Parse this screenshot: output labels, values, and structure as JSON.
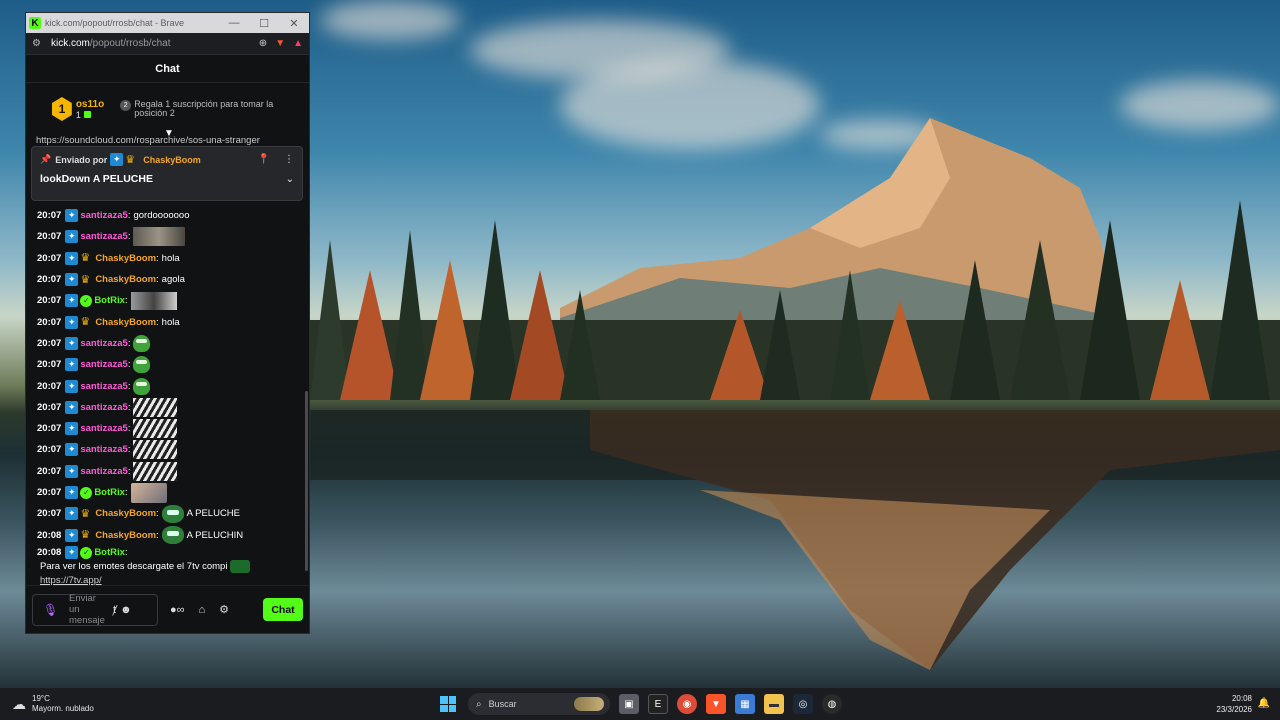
{
  "browser": {
    "tab_title": "kick.com/popout/rrosb/chat - Brave",
    "url_domain": "kick.com",
    "url_path": "/popout/rrosb/chat",
    "minimize": "—",
    "maximize": "☐",
    "close": "✕"
  },
  "chat": {
    "header": "Chat",
    "leaderboard": {
      "rank": "1",
      "username": "os11o",
      "gift_count": "1",
      "next_rank": "2",
      "next_text": "Regala 1 suscripción para tomar la posición 2"
    },
    "pinned_url": "https://soundcloud.com/rosparchive/sos-una-stranger",
    "pinned": {
      "sent_by_label": "Enviado por",
      "sender": "ChaskyBoom",
      "message": "lookDown A PELUCHE"
    },
    "messages": [
      {
        "time": "20:07",
        "badges": [
          "vip"
        ],
        "user": "santizaza5",
        "color": "#ff5bd6",
        "text": "gordooooooo",
        "emote": ""
      },
      {
        "time": "20:07",
        "badges": [
          "vip"
        ],
        "user": "santizaza5",
        "color": "#ff5bd6",
        "text": "",
        "emote": "img"
      },
      {
        "time": "20:07",
        "badges": [
          "vip",
          "crown"
        ],
        "user": "ChaskyBoom",
        "color": "#f5a623",
        "text": "hola",
        "emote": ""
      },
      {
        "time": "20:07",
        "badges": [
          "vip",
          "crown"
        ],
        "user": "ChaskyBoom",
        "color": "#f5a623",
        "text": "agola",
        "emote": ""
      },
      {
        "time": "20:07",
        "badges": [
          "vip",
          "bot"
        ],
        "user": "BotRix",
        "color": "#53fc18",
        "text": "",
        "emote": "img2"
      },
      {
        "time": "20:07",
        "badges": [
          "vip",
          "crown"
        ],
        "user": "ChaskyBoom",
        "color": "#f5a623",
        "text": "hola",
        "emote": ""
      },
      {
        "time": "20:07",
        "badges": [
          "vip"
        ],
        "user": "santizaza5",
        "color": "#ff5bd6",
        "text": "",
        "emote": "frog"
      },
      {
        "time": "20:07",
        "badges": [
          "vip"
        ],
        "user": "santizaza5",
        "color": "#ff5bd6",
        "text": "",
        "emote": "frog"
      },
      {
        "time": "20:07",
        "badges": [
          "vip"
        ],
        "user": "santizaza5",
        "color": "#ff5bd6",
        "text": "",
        "emote": "frog"
      },
      {
        "time": "20:07",
        "badges": [
          "vip"
        ],
        "user": "santizaza5",
        "color": "#ff5bd6",
        "text": "",
        "emote": "bw"
      },
      {
        "time": "20:07",
        "badges": [
          "vip"
        ],
        "user": "santizaza5",
        "color": "#ff5bd6",
        "text": "",
        "emote": "bw"
      },
      {
        "time": "20:07",
        "badges": [
          "vip"
        ],
        "user": "santizaza5",
        "color": "#ff5bd6",
        "text": "",
        "emote": "bw"
      },
      {
        "time": "20:07",
        "badges": [
          "vip"
        ],
        "user": "santizaza5",
        "color": "#ff5bd6",
        "text": "",
        "emote": "bw"
      },
      {
        "time": "20:07",
        "badges": [
          "vip",
          "bot"
        ],
        "user": "BotRix",
        "color": "#53fc18",
        "text": "",
        "emote": "face"
      },
      {
        "time": "20:07",
        "badges": [
          "vip",
          "crown"
        ],
        "user": "ChaskyBoom",
        "color": "#f5a623",
        "text": "A PELUCHE",
        "emote": "frog2"
      },
      {
        "time": "20:08",
        "badges": [
          "vip",
          "crown"
        ],
        "user": "ChaskyBoom",
        "color": "#f5a623",
        "text": "A PELUCHIN",
        "emote": "frog2"
      }
    ],
    "last_message": {
      "time": "20:08",
      "user": "BotRix",
      "color": "#53fc18",
      "text": "Para ver los emotes descargate el 7tv compi",
      "link": "https://7tv.app/"
    },
    "composer": {
      "placeholder_line1": "Enviar",
      "placeholder_line2": "un",
      "placeholder_line3": "mensaje",
      "send_label": "Chat"
    }
  },
  "taskbar": {
    "temperature": "19°C",
    "weather": "Mayorm. nublado",
    "search_placeholder": "Buscar",
    "time": "20:08",
    "date": "23/3/2026"
  },
  "colors": {
    "kick_green": "#53fc18",
    "leader_gold": "#f5b500"
  }
}
